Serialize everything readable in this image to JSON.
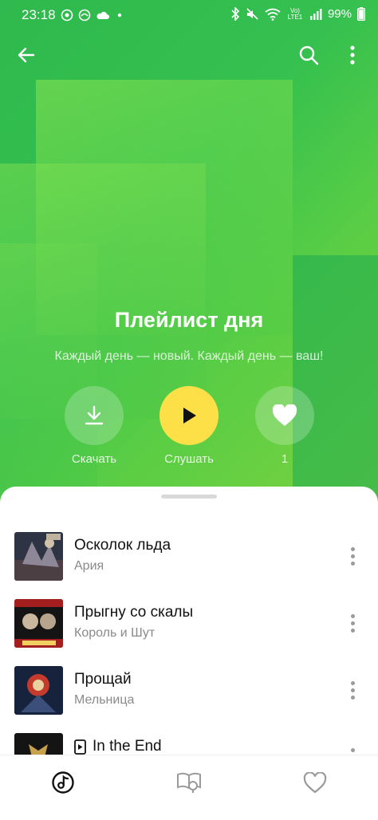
{
  "status_bar": {
    "time": "23:18",
    "battery": "99%",
    "network_label": "Vo) LTE1"
  },
  "playlist": {
    "title": "Плейлист дня",
    "subtitle": "Каждый день — новый. Каждый день — ваш!"
  },
  "actions": {
    "download_label": "Скачать",
    "play_label": "Слушать",
    "likes_count": "1"
  },
  "tracks": [
    {
      "title": "Осколок льда",
      "artist": "Ария",
      "cover_colors": [
        "#3b3b47",
        "#7a7070"
      ]
    },
    {
      "title": "Прыгну со скалы",
      "artist": "Король и Шут",
      "cover_colors": [
        "#8a1e1e",
        "#1a1a1a"
      ]
    },
    {
      "title": "Прощай",
      "artist": "Мельница",
      "cover_colors": [
        "#1d2a4a",
        "#c0392b"
      ]
    },
    {
      "title": "In the End",
      "artist": "",
      "cover_colors": [
        "#1a1a1a",
        "#c8a24a"
      ]
    }
  ],
  "colors": {
    "accent_green": "#35c04f",
    "play_yellow": "#fde047"
  },
  "icons": {
    "back": "arrow-left-icon",
    "search": "search-icon",
    "more": "more-vertical-icon",
    "download": "download-icon",
    "play": "play-icon",
    "like": "heart-icon",
    "nav_music": "music-note-icon",
    "nav_podcasts": "podcast-book-icon",
    "nav_favorites": "heart-outline-icon"
  }
}
